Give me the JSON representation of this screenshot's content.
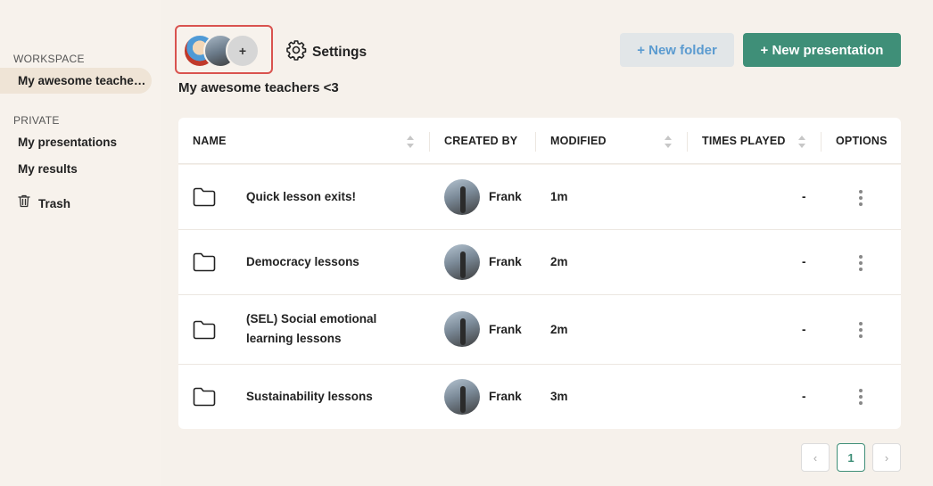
{
  "sidebar": {
    "workspace_label": "WORKSPACE",
    "active_workspace": "My awesome teachers <3",
    "private_label": "PRIVATE",
    "items": [
      {
        "label": "My presentations"
      },
      {
        "label": "My results"
      }
    ],
    "trash_label": "Trash"
  },
  "header": {
    "add_member_symbol": "+",
    "settings_label": "Settings",
    "new_folder_label": "+ New folder",
    "new_presentation_label": "+ New presentation",
    "workspace_title": "My awesome teachers <3"
  },
  "table": {
    "columns": {
      "name": "NAME",
      "created_by": "CREATED BY",
      "modified": "MODIFIED",
      "times_played": "TIMES PLAYED",
      "options": "OPTIONS"
    },
    "rows": [
      {
        "name": "Quick lesson exits!",
        "created_by": "Frank",
        "modified": "1m",
        "times_played": "-"
      },
      {
        "name": "Democracy lessons",
        "created_by": "Frank",
        "modified": "2m",
        "times_played": "-"
      },
      {
        "name": "(SEL) Social emotional learning lessons",
        "created_by": "Frank",
        "modified": "2m",
        "times_played": "-"
      },
      {
        "name": "Sustainability lessons",
        "created_by": "Frank",
        "modified": "3m",
        "times_played": "-"
      }
    ]
  },
  "pagination": {
    "prev": "‹",
    "current": "1",
    "next": "›"
  },
  "colors": {
    "accent": "#3f8f78",
    "highlight_border": "#d9534f",
    "background": "#f7f2ec"
  }
}
